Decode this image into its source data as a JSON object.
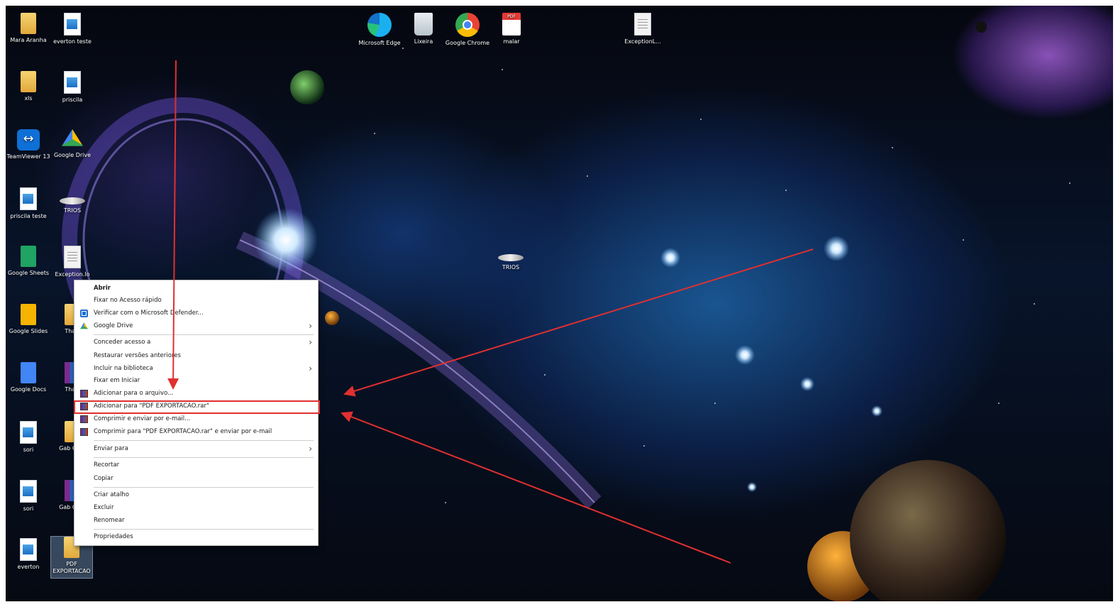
{
  "desktop_icons": [
    {
      "label": "Mara Aranha",
      "icon": "folder-icon"
    },
    {
      "label": "everton teste",
      "icon": "image-file-icon"
    },
    {
      "label": "xls",
      "icon": "folder-icon"
    },
    {
      "label": "priscila",
      "icon": "image-file-icon"
    },
    {
      "label": "TeamViewer 13",
      "icon": "teamviewer-icon"
    },
    {
      "label": "Google Drive",
      "icon": "google-drive-icon"
    },
    {
      "label": "priscila teste",
      "icon": "image-file-icon"
    },
    {
      "label": "TRIOS",
      "icon": "spaceship-icon"
    },
    {
      "label": "Google Sheets",
      "icon": "google-sheets-icon"
    },
    {
      "label": "Exception.lo",
      "icon": "text-file-icon"
    },
    {
      "label": "Google Slides",
      "icon": "google-slides-icon"
    },
    {
      "label": "Thais",
      "icon": "folder-icon"
    },
    {
      "label": "Google Docs",
      "icon": "google-docs-icon"
    },
    {
      "label": "Thais",
      "icon": "winrar-archive-icon"
    },
    {
      "label": "sori",
      "icon": "image-file-icon"
    },
    {
      "label": "Gab Cura",
      "icon": "folder-icon"
    },
    {
      "label": "sori",
      "icon": "image-file-icon"
    },
    {
      "label": "Gab Cura",
      "icon": "winrar-archive-icon"
    },
    {
      "label": "everton",
      "icon": "image-file-icon"
    },
    {
      "label": "PDF EXPORTACAO",
      "icon": "folder-icon",
      "selected": true
    },
    {
      "label": "Microsoft Edge",
      "icon": "edge-icon"
    },
    {
      "label": "Lixeira",
      "icon": "recycle-bin-icon"
    },
    {
      "label": "Google Chrome",
      "icon": "chrome-icon"
    },
    {
      "label": "malar",
      "icon": "pdf-file-icon"
    },
    {
      "label": "ExceptionL...",
      "icon": "text-file-icon"
    },
    {
      "label": "TRIOS",
      "icon": "spaceship-icon"
    }
  ],
  "context_menu": {
    "open": "Abrir",
    "pin_quick_access": "Fixar no Acesso rápido",
    "defender_scan": "Verificar com o Microsoft Defender...",
    "google_drive": "Google Drive",
    "grant_access": "Conceder acesso a",
    "restore_versions": "Restaurar versões anteriores",
    "include_library": "Incluir na biblioteca",
    "pin_start": "Fixar em Iniciar",
    "add_to_archive": "Adicionar para o arquivo...",
    "add_to_rar": "Adicionar para \"PDF EXPORTACAO.rar\"",
    "compress_email": "Comprimir e enviar por e-mail...",
    "compress_rar_email": "Comprimir para \"PDF EXPORTACAO.rar\" e enviar por e-mail",
    "send_to": "Enviar para",
    "cut": "Recortar",
    "copy": "Copiar",
    "create_shortcut": "Criar atalho",
    "delete": "Excluir",
    "rename": "Renomear",
    "properties": "Propriedades"
  },
  "colors": {
    "annotation_red": "#e03030",
    "menu_background": "#ffffff"
  }
}
